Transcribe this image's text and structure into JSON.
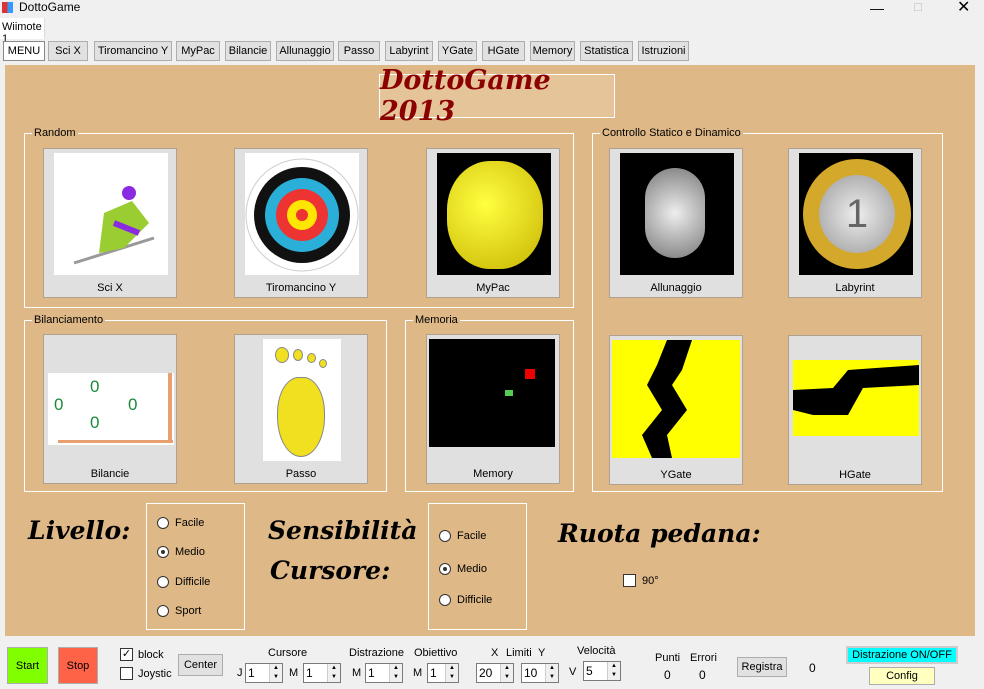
{
  "window": {
    "title": "DottoGame"
  },
  "tabs": [
    "Wiimote 1"
  ],
  "nav": [
    "MENU",
    "Sci X",
    "Tiromancino Y",
    "MyPac",
    "Bilancie",
    "Allunaggio",
    "Passo",
    "Labyrint",
    "YGate",
    "HGate",
    "Memory",
    "Statistica",
    "Istruzioni"
  ],
  "banner": "DottoGame 2013",
  "groups": {
    "random": "Random",
    "controllo": "Controllo Statico e Dinamico",
    "bilanciamento": "Bilanciamento",
    "memoria": "Memoria"
  },
  "games": {
    "scix": "Sci X",
    "tiro": "Tiromancino Y",
    "mypac": "MyPac",
    "allunaggio": "Allunaggio",
    "labyrint": "Labyrint",
    "ygate": "YGate",
    "hgate": "HGate",
    "bilancie": "Bilancie",
    "passo": "Passo",
    "memory": "Memory"
  },
  "bilancie_values": [
    "0",
    "0",
    "0",
    "0"
  ],
  "livello": {
    "label": "Livello:",
    "options": [
      "Facile",
      "Medio",
      "Difficile",
      "Sport"
    ],
    "selected": "Medio"
  },
  "sensibilita": {
    "label1": "Sensibilità",
    "label2": "Cursore:",
    "options": [
      "Facile",
      "Medio",
      "Difficile"
    ],
    "selected": "Medio"
  },
  "ruota": {
    "label": "Ruota pedana:",
    "check_label": "90°",
    "checked": false
  },
  "bottom": {
    "start": "Start",
    "stop": "Stop",
    "block": "block",
    "joystic": "Joystic",
    "center": "Center",
    "cursore": "Cursore",
    "distrazione": "Distrazione",
    "obiettivo": "Obiettivo",
    "x": "X",
    "limiti": "Limiti",
    "y": "Y",
    "velocita": "Velocità",
    "j": "J",
    "m": "M",
    "v": "V",
    "j_val": "1",
    "cm_val": "1",
    "dm_val": "1",
    "om_val": "1",
    "x_val": "20",
    "y_val": "10",
    "v_val": "5",
    "punti": "Punti",
    "errori": "Errori",
    "punti_val": "0",
    "errori_val": "0",
    "registra": "Registra",
    "registra_val": "0",
    "distrazione_btn": "Distrazione ON/OFF",
    "config": "Config"
  },
  "colors": {
    "panel": "#deb887",
    "start": "#80ff00",
    "stop": "#ff6347",
    "distrazione": "#00ffff",
    "config": "#ffffc0",
    "banner": "#8b0000"
  }
}
